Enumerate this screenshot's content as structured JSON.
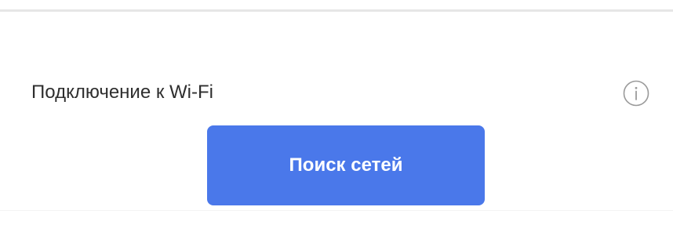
{
  "wifi_section": {
    "title": "Подключение к Wi-Fi",
    "info_icon": "info-icon",
    "search_button_label": "Поиск сетей"
  },
  "colors": {
    "primary_button": "#4a78ea",
    "button_text": "#ffffff",
    "label_text": "#2e2e2e",
    "icon_stroke": "#9a9a9a",
    "divider": "#e6e6e6",
    "background": "#ffffff"
  }
}
